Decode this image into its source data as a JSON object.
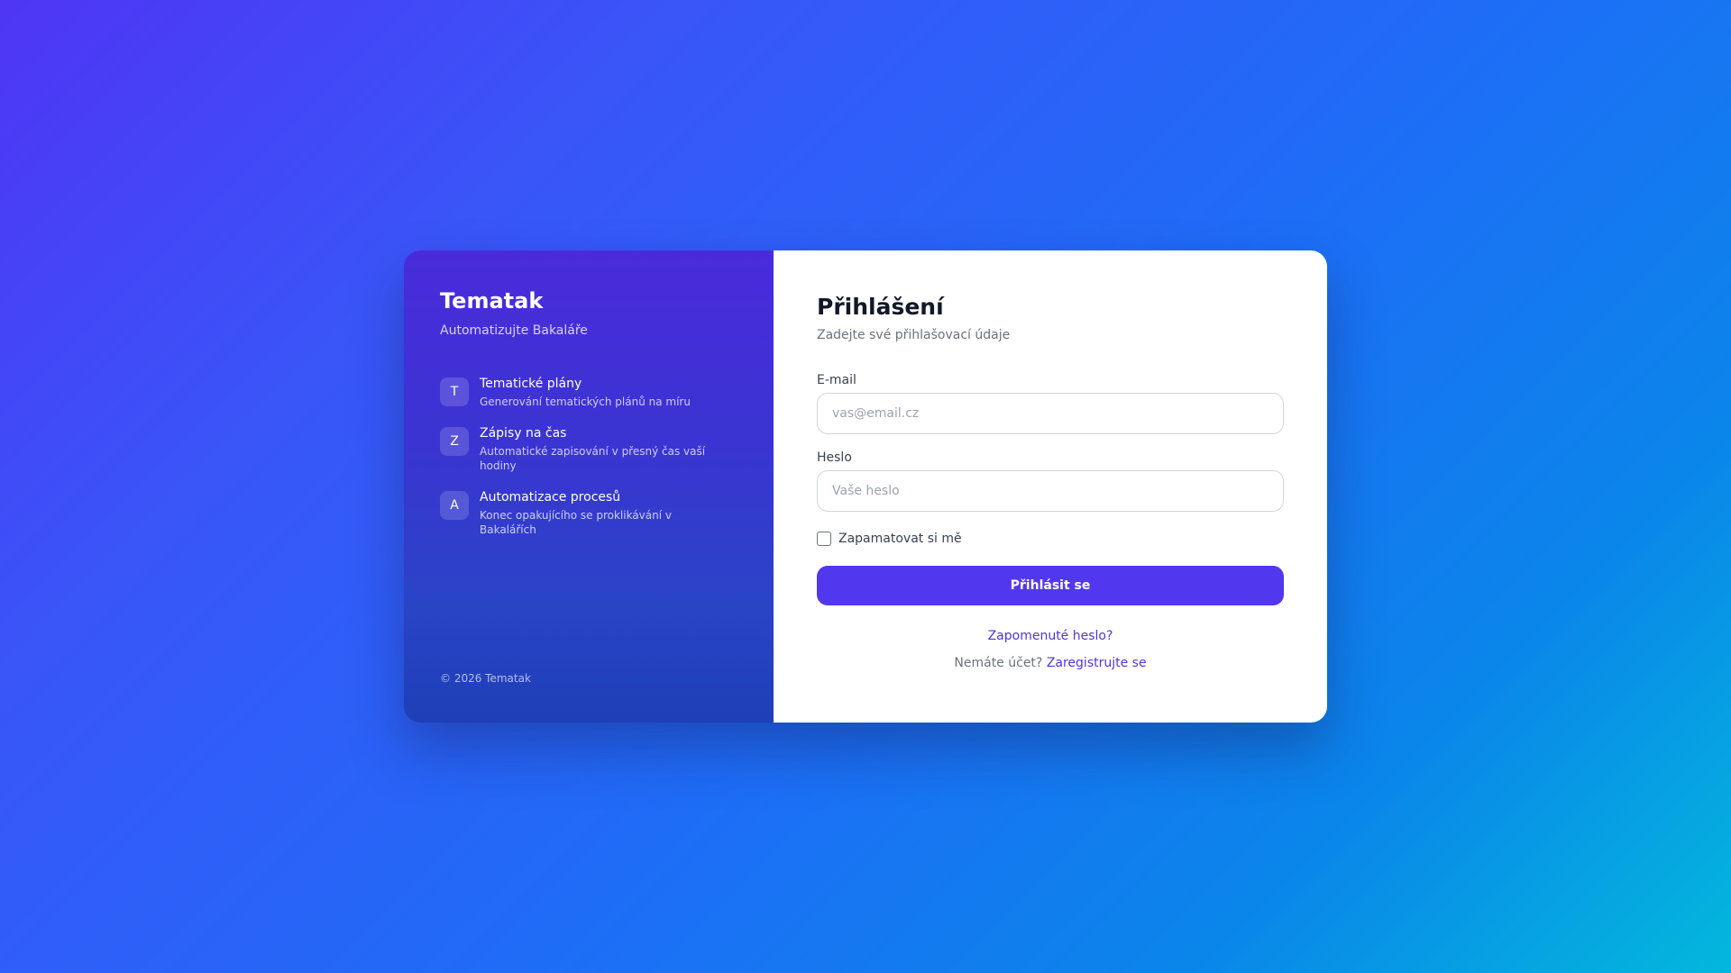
{
  "brand": {
    "title": "Tematak",
    "subtitle": "Automatizujte Bakaláře"
  },
  "features": [
    {
      "icon_letter": "T",
      "title": "Tematické plány",
      "description": "Generování tematických plánů na míru"
    },
    {
      "icon_letter": "Z",
      "title": "Zápisy na čas",
      "description": "Automatické zapisování v přesný čas vaší hodiny"
    },
    {
      "icon_letter": "A",
      "title": "Automatizace procesů",
      "description": "Konec opakujícího se proklikávání v Bakalářích"
    }
  ],
  "copyright": "© 2026 Tematak",
  "login": {
    "title": "Přihlášení",
    "subtitle": "Zadejte své přihlašovací údaje",
    "email_label": "E-mail",
    "email_placeholder": "vas@email.cz",
    "email_value": "",
    "password_label": "Heslo",
    "password_placeholder": "Vaše heslo",
    "password_value": "",
    "remember_label": "Zapamatovat si mě",
    "remember_checked": false,
    "submit_label": "Přihlásit se",
    "forgot_link": "Zapomenuté heslo?",
    "no_account_text": "Nemáte účet?",
    "register_link": "Zaregistrujte se"
  },
  "colors": {
    "accent": "#5137ee",
    "link": "#4f35e0",
    "panel_top": "#4a2bdb",
    "panel_bottom": "#1e3fb8"
  }
}
